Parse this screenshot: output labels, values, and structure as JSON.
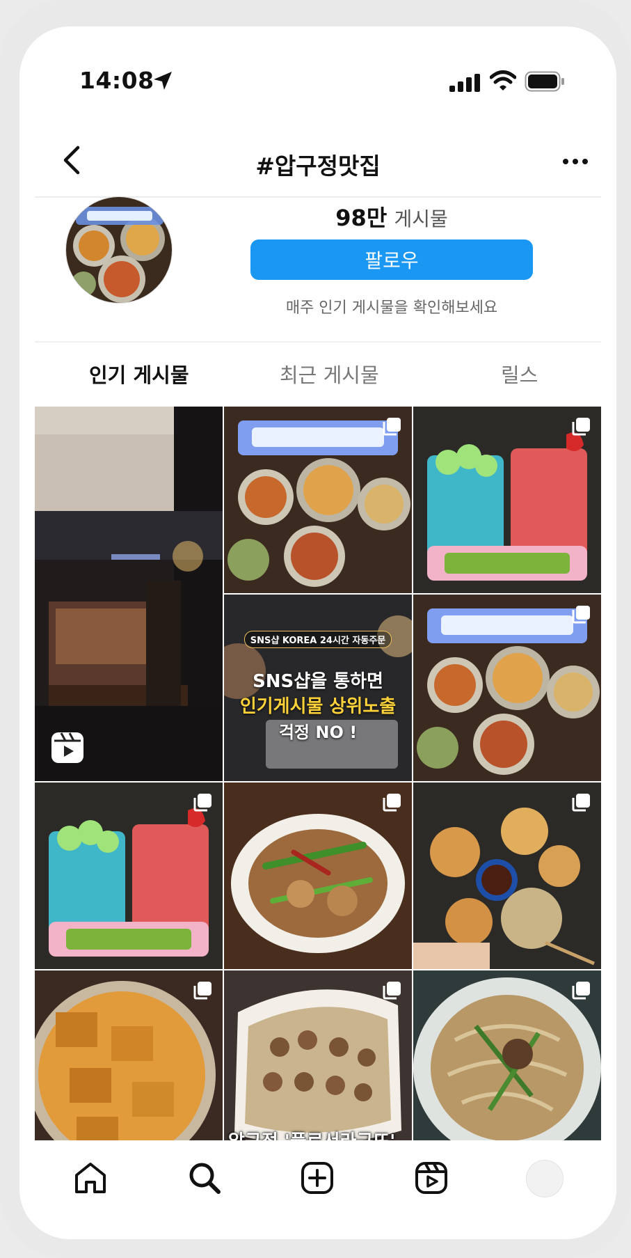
{
  "status_bar": {
    "time": "14:08"
  },
  "header": {
    "title": "#압구정맛집"
  },
  "profile": {
    "post_count": "98만",
    "post_count_label": "게시물",
    "follow_label": "팔로우",
    "hint": "매주 인기 게시물을 확인해보세요"
  },
  "tabs": [
    {
      "label": "인기 게시물",
      "active": true
    },
    {
      "label": "최근 게시물",
      "active": false
    },
    {
      "label": "릴스",
      "active": false
    }
  ],
  "grid": {
    "ad": {
      "badge": "SNS샵 KOREA 24시간 자동주문",
      "line1": "SNS샵을 통하면",
      "line2": "인기게시물 상위노출",
      "line3": "걱정 NO !"
    },
    "caption_last_row": "압구정 '플르서라구뜨'"
  },
  "icons": {
    "status": [
      "location-arrow-icon",
      "cellular-signal-icon",
      "wifi-icon",
      "battery-icon"
    ],
    "header": [
      "back-chevron-icon",
      "more-icon"
    ],
    "nav": [
      "home-icon",
      "search-icon",
      "create-icon",
      "reels-icon",
      "profile-avatar"
    ]
  },
  "colors": {
    "accent": "#1a96f3",
    "text": "#111111",
    "muted": "#777777"
  }
}
